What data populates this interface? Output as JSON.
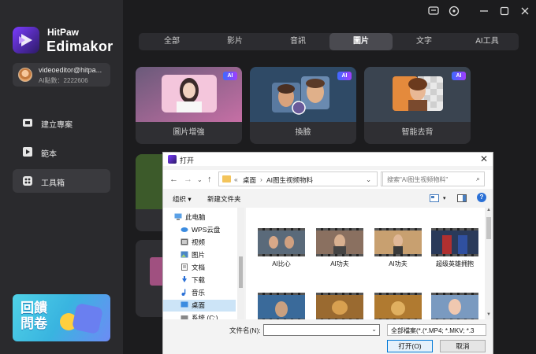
{
  "app": {
    "brand_line1": "HitPaw",
    "brand_line2": "Edimakor"
  },
  "user": {
    "email": "videoeditor@hitpa...",
    "points": "AI點數：2222606"
  },
  "sidebar": {
    "items": [
      {
        "label": "建立專案",
        "icon": "project-icon"
      },
      {
        "label": "範本",
        "icon": "template-icon"
      },
      {
        "label": "工具箱",
        "icon": "toolbox-icon"
      }
    ],
    "banner": {
      "line1": "回饋",
      "line2": "問卷"
    }
  },
  "tabs": [
    "全部",
    "影片",
    "音訊",
    "圖片",
    "文字",
    "AI工具"
  ],
  "active_tab": "圖片",
  "cards": [
    {
      "caption": "圖片增強",
      "badge": "AI"
    },
    {
      "caption": "換臉",
      "badge": "AI"
    },
    {
      "caption": "智能去背",
      "badge": "AI"
    }
  ],
  "colors": {
    "accent": "#7b3cff",
    "badge_gradient_start": "#3d6bff",
    "badge_gradient_end": "#a23dff"
  },
  "dialog": {
    "title": "打开",
    "path_sep": "«",
    "path": [
      "桌面",
      "AI图生视频物料"
    ],
    "search_placeholder": "搜索\"AI图生视频物料\"",
    "toolbar": {
      "organize": "组织 ▾",
      "new_folder": "新建文件夹"
    },
    "tree": [
      {
        "label": "此电脑",
        "icon": "computer-icon"
      },
      {
        "label": "WPS云盘",
        "icon": "cloud-icon"
      },
      {
        "label": "视频",
        "icon": "video-folder-icon"
      },
      {
        "label": "图片",
        "icon": "image-folder-icon"
      },
      {
        "label": "文档",
        "icon": "document-folder-icon"
      },
      {
        "label": "下载",
        "icon": "download-icon"
      },
      {
        "label": "音乐",
        "icon": "music-icon"
      },
      {
        "label": "桌面",
        "icon": "desktop-icon"
      },
      {
        "label": "系统 (C:)",
        "icon": "drive-icon"
      }
    ],
    "files": [
      {
        "name": "AI比心"
      },
      {
        "name": "AI功夫"
      },
      {
        "name": "AI功夫"
      },
      {
        "name": "超级英雄拥抱"
      },
      {
        "name": ""
      },
      {
        "name": ""
      },
      {
        "name": ""
      },
      {
        "name": ""
      }
    ],
    "filename_label": "文件名(N):",
    "filename_value": "",
    "filetype_value": "全部檔案(*.(*.MP4; *.MKV; *.3",
    "open_button": "打开(O)",
    "cancel_button": "取消"
  }
}
